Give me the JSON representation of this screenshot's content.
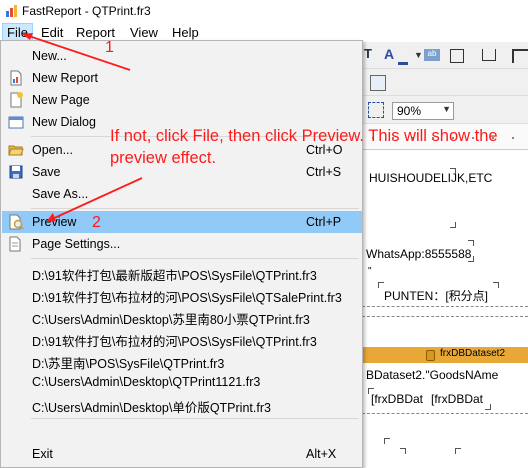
{
  "window": {
    "title": "FastReport - QTPrint.fr3"
  },
  "menubar": {
    "file": "File",
    "edit": "Edit",
    "report": "Report",
    "view": "View",
    "help": "Help"
  },
  "toolbar": {
    "zoom": "90%"
  },
  "file_menu": {
    "new": "New...",
    "new_report": "New Report",
    "new_page": "New Page",
    "new_dialog": "New Dialog",
    "open": "Open...",
    "open_shortcut": "Ctrl+O",
    "save": "Save",
    "save_shortcut": "Ctrl+S",
    "save_as": "Save As...",
    "preview": "Preview",
    "preview_shortcut": "Ctrl+P",
    "page_settings": "Page Settings...",
    "recent": [
      "D:\\91软件打包\\最新版超市\\POS\\SysFile\\QTPrint.fr3",
      "D:\\91软件打包\\布拉材的河\\POS\\SysFile\\QTSalePrint.fr3",
      "C:\\Users\\Admin\\Desktop\\苏里南80小票QTPrint.fr3",
      "D:\\91软件打包\\布拉材的河\\POS\\SysFile\\QTPrint.fr3",
      "D:\\苏里南\\POS\\SysFile\\QTPrint.fr3",
      "C:\\Users\\Admin\\Desktop\\QTPrint1121.fr3",
      "C:\\Users\\Admin\\Desktop\\单价版QTPrint.fr3"
    ],
    "exit": "Exit",
    "exit_shortcut": "Alt+X"
  },
  "report_page": {
    "text1": "HUISHOUDELIJK,ETC",
    "text2": "WhatsApp:8555588",
    "text3": "\"",
    "text4": "PUNTEN：[积分点]",
    "band_title": "frxDBDataset2",
    "text5": "BDataset2.\"GoodsNAme",
    "text6": "[frxDBDat",
    "text7": "[frxDBDat"
  },
  "annotation": {
    "note": "If not, click File, then click Preview. This will show the preview effect.",
    "step1": "1",
    "step2": "2",
    "color": "#ff1a1a"
  }
}
